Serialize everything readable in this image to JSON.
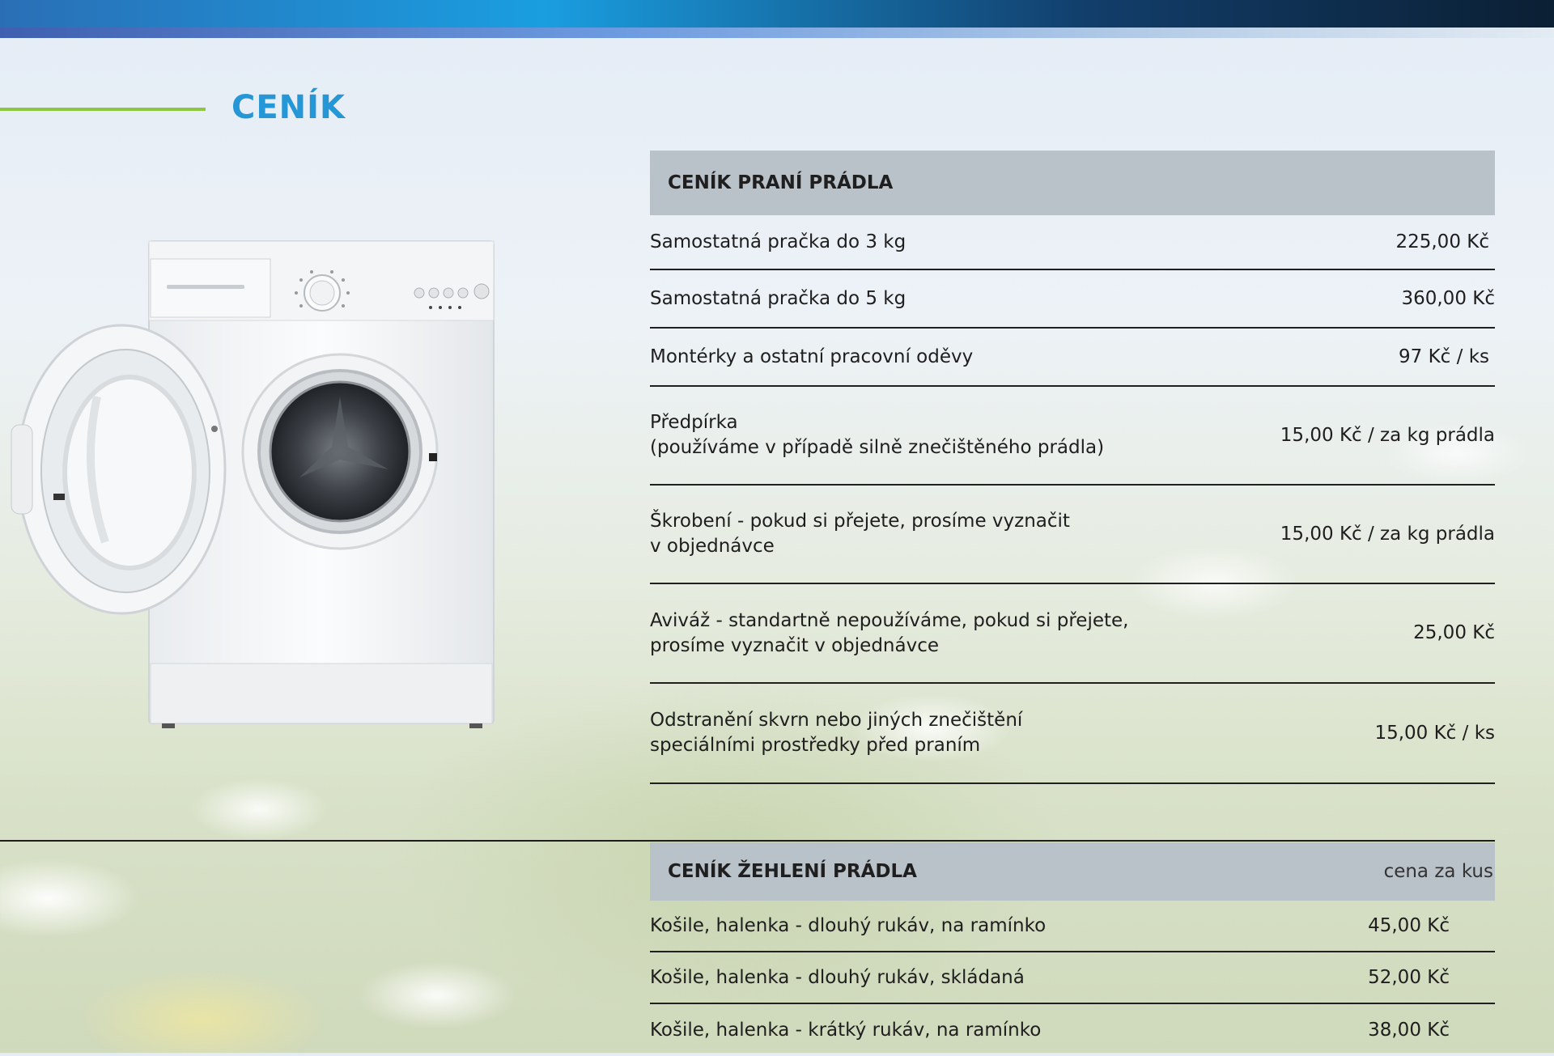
{
  "page": {
    "title": "CENÍK"
  },
  "image": {
    "icon": "washing-machine-illustration"
  },
  "washing": {
    "title": "CENÍK PRANÍ PRÁDLA",
    "rows": [
      {
        "label": "Samostatná pračka do 3 kg",
        "price": "225,00 Kč"
      },
      {
        "label": "Samostatná pračka do 5 kg",
        "price": "360,00 Kč"
      },
      {
        "label": "Montérky a ostatní pracovní oděvy",
        "price": "97 Kč / ks"
      },
      {
        "label": "Předpírka\n(používáme v případě silně znečištěného prádla)",
        "price": "15,00 Kč / za kg prádla"
      },
      {
        "label": "Škrobení - pokud si přejete, prosíme vyznačit\nv objednávce",
        "price": "15,00 Kč / za kg prádla"
      },
      {
        "label": "Aviváž - standartně nepoužíváme, pokud si přejete,\nprosíme vyznačit v objednávce",
        "price": "25,00 Kč"
      },
      {
        "label": "Odstranění skvrn nebo jiných znečištění\nspeciálními prostředky před praním",
        "price": "15,00 Kč / ks"
      }
    ]
  },
  "ironing": {
    "title": "CENÍK ŽEHLENÍ PRÁDLA",
    "subtitle": "cena za kus",
    "rows": [
      {
        "label": "Košile, halenka  - dlouhý rukáv, na ramínko",
        "price": "45,00 Kč"
      },
      {
        "label": "Košile, halenka  - dlouhý rukáv, skládaná",
        "price": "52,00 Kč"
      },
      {
        "label": "Košile, halenka  - krátký rukáv, na ramínko",
        "price": "38,00 Kč"
      }
    ]
  },
  "colors": {
    "accent_blue": "#2596d6",
    "accent_green": "#8dc63f",
    "header_gray": "#b9c1c9"
  }
}
